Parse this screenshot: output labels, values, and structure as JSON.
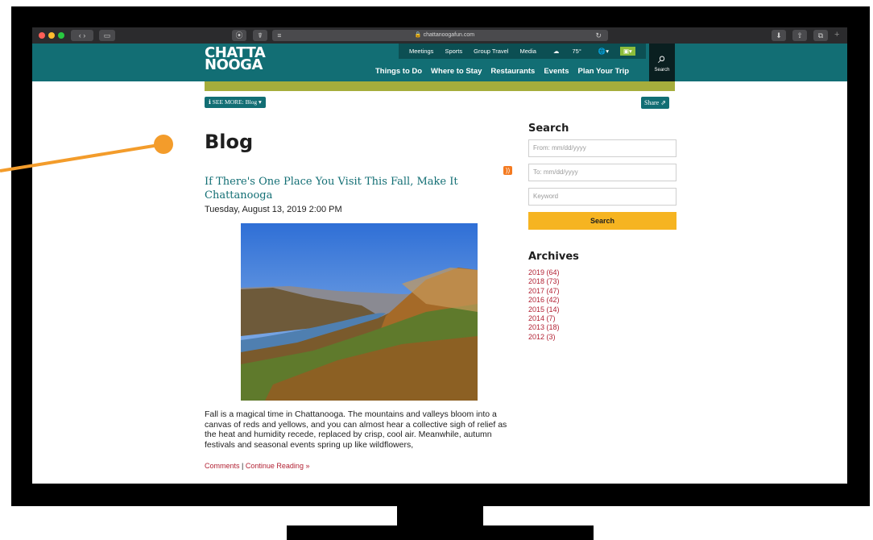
{
  "browser": {
    "url": "chattanoogafun.com"
  },
  "site": {
    "logo_line1": "CHATTA",
    "logo_line2": "NOOGA",
    "util_nav": [
      "Meetings",
      "Sports",
      "Group Travel",
      "Media"
    ],
    "weather": "75°",
    "main_nav": [
      "Things to Do",
      "Where to Stay",
      "Restaurants",
      "Events",
      "Plan Your Trip"
    ],
    "search_label": "Search",
    "see_more": "SEE MORE: Blog",
    "share": "Share"
  },
  "blog": {
    "heading": "Blog",
    "post": {
      "title": "If There's One Place You Visit This Fall, Make It Chattanooga",
      "date": "Tuesday, August 13, 2019 2:00 PM",
      "excerpt": "Fall is a magical time in Chattanooga. The mountains and valleys bloom into a canvas of reds and yellows, and you can almost hear a collective sigh of relief as the heat and humidity recede, replaced by crisp, cool air. Meanwhile, autumn festivals and seasonal events spring up like wildflowers,",
      "comments_link": "Comments",
      "separator": "|",
      "continue_link": "Continue Reading »"
    }
  },
  "sidebar": {
    "search_heading": "Search",
    "from_placeholder": "From: mm/dd/yyyy",
    "to_placeholder": "To: mm/dd/yyyy",
    "keyword_placeholder": "Keyword",
    "search_button": "Search",
    "archives_heading": "Archives",
    "archives": [
      "2019 (64)",
      "2018 (73)",
      "2017 (47)",
      "2016 (42)",
      "2015 (14)",
      "2014 (7)",
      "2013 (18)",
      "2012 (3)"
    ]
  },
  "colors": {
    "brand_teal": "#126e74",
    "olive": "#a6ad3c",
    "accent_orange": "#f39c2b",
    "search_yellow": "#f6b421",
    "link_red": "#b22234"
  }
}
